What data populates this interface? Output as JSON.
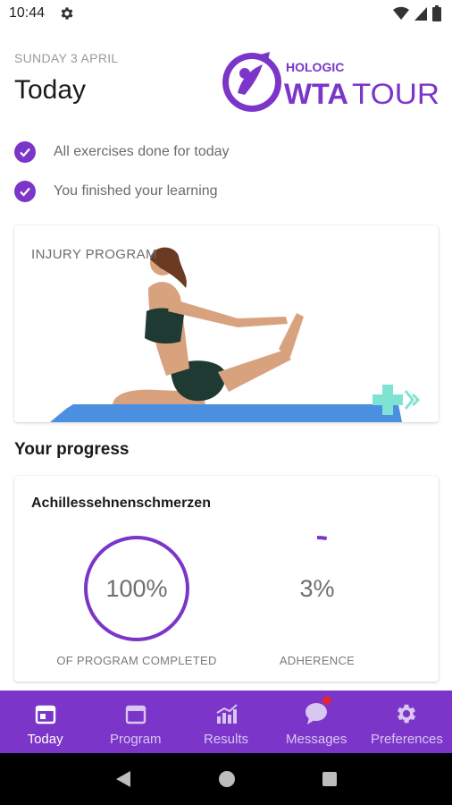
{
  "status_bar": {
    "time": "10:44",
    "icons": [
      "gear-icon",
      "wifi-icon",
      "signal-icon",
      "battery-icon"
    ]
  },
  "header": {
    "date": "SUNDAY 3 APRIL",
    "title": "Today",
    "brand_top": "HOLOGIC",
    "brand_wta": "WTA",
    "brand_tour": "TOUR"
  },
  "checklist": [
    {
      "text": "All exercises done for today",
      "icon": "check-icon"
    },
    {
      "text": "You finished your learning",
      "icon": "check-icon"
    }
  ],
  "injury_card": {
    "label": "INJURY PROGRAM"
  },
  "progress": {
    "section_title": "Your progress",
    "program_name": "Achillessehnenschmerzen",
    "completed": {
      "value_text": "100%",
      "fraction": 1.0,
      "caption": "OF PROGRAM COMPLETED"
    },
    "adherence": {
      "value_text": "3%",
      "fraction": 0.03,
      "caption": "ADHERENCE"
    }
  },
  "tabs": [
    {
      "label": "Today",
      "icon": "calendar-day-icon",
      "active": true
    },
    {
      "label": "Program",
      "icon": "calendar-icon",
      "active": false
    },
    {
      "label": "Results",
      "icon": "chart-icon",
      "active": false
    },
    {
      "label": "Messages",
      "icon": "chat-icon",
      "active": false,
      "badge": true
    },
    {
      "label": "Preferences",
      "icon": "gear-icon",
      "active": false
    }
  ],
  "colors": {
    "brand_purple": "#7b36c9",
    "accent_teal": "#7fe3d4",
    "mat_blue": "#4a8fe0",
    "badge_red": "#e0243c"
  }
}
